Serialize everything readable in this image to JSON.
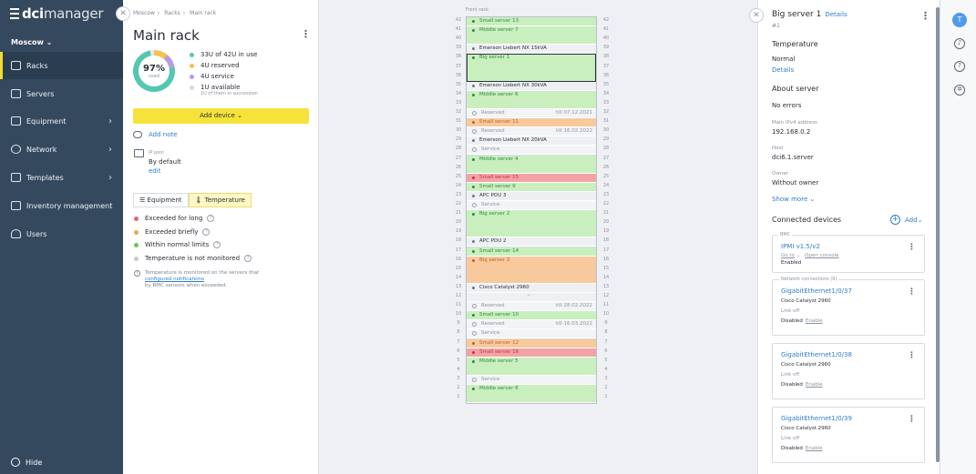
{
  "sidebar": {
    "logo_bold": "dci",
    "logo_thin": "manager",
    "location": "Moscow",
    "items": [
      {
        "label": "Racks",
        "has_chevron": false
      },
      {
        "label": "Servers",
        "has_chevron": false
      },
      {
        "label": "Equipment",
        "has_chevron": true
      },
      {
        "label": "Network",
        "has_chevron": true
      },
      {
        "label": "Templates",
        "has_chevron": true
      },
      {
        "label": "Inventory management",
        "has_chevron": false
      },
      {
        "label": "Users",
        "has_chevron": false
      }
    ],
    "hide_label": "Hide"
  },
  "rack_panel": {
    "breadcrumb": [
      "Moscow",
      "Racks",
      "Main rack"
    ],
    "title": "Main rack",
    "usage": {
      "percent_label": "97%",
      "used_label": "used",
      "used_fraction": 0.97
    },
    "stats": [
      {
        "label": "33U of 42U in use",
        "color": "#53c7b1"
      },
      {
        "label": "4U reserved",
        "color": "#f5c14f"
      },
      {
        "label": "4U service",
        "color": "#b89be3"
      },
      {
        "label": "1U available",
        "color": "#d5d9de"
      }
    ],
    "stats_sub": "1U of them in succession",
    "add_device": "Add device",
    "add_note": "Add note",
    "ip_pool_label": "IP pool",
    "ip_pool_value": "By default",
    "ip_pool_edit": "edit",
    "tabs": [
      {
        "label": "Equipment"
      },
      {
        "label": "Temperature"
      }
    ],
    "legend": [
      {
        "label": "Exceeded for long",
        "color": "#e8636a"
      },
      {
        "label": "Exceeded briefly",
        "color": "#f5a34f"
      },
      {
        "label": "Within normal limits",
        "color": "#6cc35c"
      },
      {
        "label": "Temperature is not monitored",
        "color": "#c5cad1"
      }
    ],
    "note_prefix": "Temperature is monitored on the servers that",
    "note_link": "configured notifications",
    "note_suffix": "by BMC sensors when exceeded."
  },
  "rack": {
    "front_label": "Front rack",
    "units": [
      {
        "u": 42,
        "label": "Small server 13",
        "kind": "srv",
        "size": 1
      },
      {
        "u": 41,
        "label": "Middle server 7",
        "kind": "srv",
        "size": 2
      },
      {
        "u": 39,
        "label": "Emerson Liebert NX 15kVA",
        "kind": "sw",
        "size": 1
      },
      {
        "u": 38,
        "label": "Big server 1",
        "kind": "srv sel",
        "size": 3
      },
      {
        "u": 35,
        "label": "Emerson Liebert NX 30kVA",
        "kind": "sw",
        "size": 1
      },
      {
        "u": 34,
        "label": "Middle server 6",
        "kind": "srv",
        "size": 2
      },
      {
        "u": 32,
        "label": "Reserved",
        "kind": "res",
        "size": 1,
        "till": "till 07.12.2021"
      },
      {
        "u": 31,
        "label": "Small server 11",
        "kind": "orange",
        "size": 1
      },
      {
        "u": 30,
        "label": "Reserved",
        "kind": "res",
        "size": 1,
        "till": "till 16.02.2022"
      },
      {
        "u": 29,
        "label": "Emerson Liebert NX 20kVA",
        "kind": "sw",
        "size": 1
      },
      {
        "u": 28,
        "label": "Service",
        "kind": "res",
        "size": 1
      },
      {
        "u": 27,
        "label": "Middle server 4",
        "kind": "srv",
        "size": 2
      },
      {
        "u": 25,
        "label": "Small server 15",
        "kind": "red",
        "size": 1
      },
      {
        "u": 24,
        "label": "Small server 9",
        "kind": "srv",
        "size": 1
      },
      {
        "u": 23,
        "label": "APC PDU 3",
        "kind": "sw",
        "size": 1
      },
      {
        "u": 22,
        "label": "Service",
        "kind": "res",
        "size": 1
      },
      {
        "u": 21,
        "label": "Big server 2",
        "kind": "srv",
        "size": 3
      },
      {
        "u": 18,
        "label": "APC PDU 2",
        "kind": "sw",
        "size": 1
      },
      {
        "u": 17,
        "label": "Small server 14",
        "kind": "srv",
        "size": 1
      },
      {
        "u": 16,
        "label": "Big server 3",
        "kind": "orange",
        "size": 3
      },
      {
        "u": 13,
        "label": "Cisco Catalyst 2960",
        "kind": "sw",
        "size": 1
      },
      {
        "u": 12,
        "label": "",
        "kind": "empty",
        "size": 1
      },
      {
        "u": 11,
        "label": "Reserved",
        "kind": "res",
        "size": 1,
        "till": "till 28.02.2022"
      },
      {
        "u": 10,
        "label": "Small server 10",
        "kind": "srv",
        "size": 1
      },
      {
        "u": 9,
        "label": "Reserved",
        "kind": "res",
        "size": 1,
        "till": "till 16.03.2022"
      },
      {
        "u": 8,
        "label": "Service",
        "kind": "res",
        "size": 1
      },
      {
        "u": 7,
        "label": "Small server 12",
        "kind": "orange",
        "size": 1
      },
      {
        "u": 6,
        "label": "Small server 16",
        "kind": "red",
        "size": 1
      },
      {
        "u": 5,
        "label": "Middle server 5",
        "kind": "srv",
        "size": 2
      },
      {
        "u": 3,
        "label": "Service",
        "kind": "res",
        "size": 1
      },
      {
        "u": 2,
        "label": "Middle server 8",
        "kind": "srv",
        "size": 2
      }
    ]
  },
  "details": {
    "title": "Big server 1",
    "details_link": "Details",
    "subtitle": "#1",
    "temperature_heading": "Temperature",
    "temperature_value": "Normal",
    "temperature_link": "Details",
    "about_heading": "About server",
    "errors": "No errors",
    "ip_label": "Main IPv4 address",
    "ip_value": "192.168.0.2",
    "host_label": "Host",
    "host_value": "dci6.1.server",
    "owner_label": "Owner",
    "owner_value": "Without owner",
    "show_more": "Show more",
    "connected_heading": "Connected devices",
    "add_label": "Add",
    "bmc": {
      "caption": "BMC",
      "name": "IPMI v1.5/v2",
      "goto": "Go to",
      "console": "Open console",
      "status": "Enabled"
    },
    "net_caption": "Network connections (9)",
    "ports": [
      {
        "name": "GigabitEthernet1/0/37",
        "device": "Cisco Catalyst 2960",
        "link": "Link off",
        "state": "Disabled",
        "action": "Enable"
      },
      {
        "name": "GigabitEthernet1/0/38",
        "device": "Cisco Catalyst 2960",
        "link": "Link off",
        "state": "Disabled",
        "action": "Enable"
      },
      {
        "name": "GigabitEthernet1/0/39",
        "device": "Cisco Catalyst 2960",
        "link": "Link off",
        "state": "Disabled",
        "action": "Enable"
      }
    ]
  },
  "toolbar": {
    "avatar_letter": "T",
    "icons": [
      "bell-icon",
      "help-icon",
      "settings-icon"
    ]
  }
}
